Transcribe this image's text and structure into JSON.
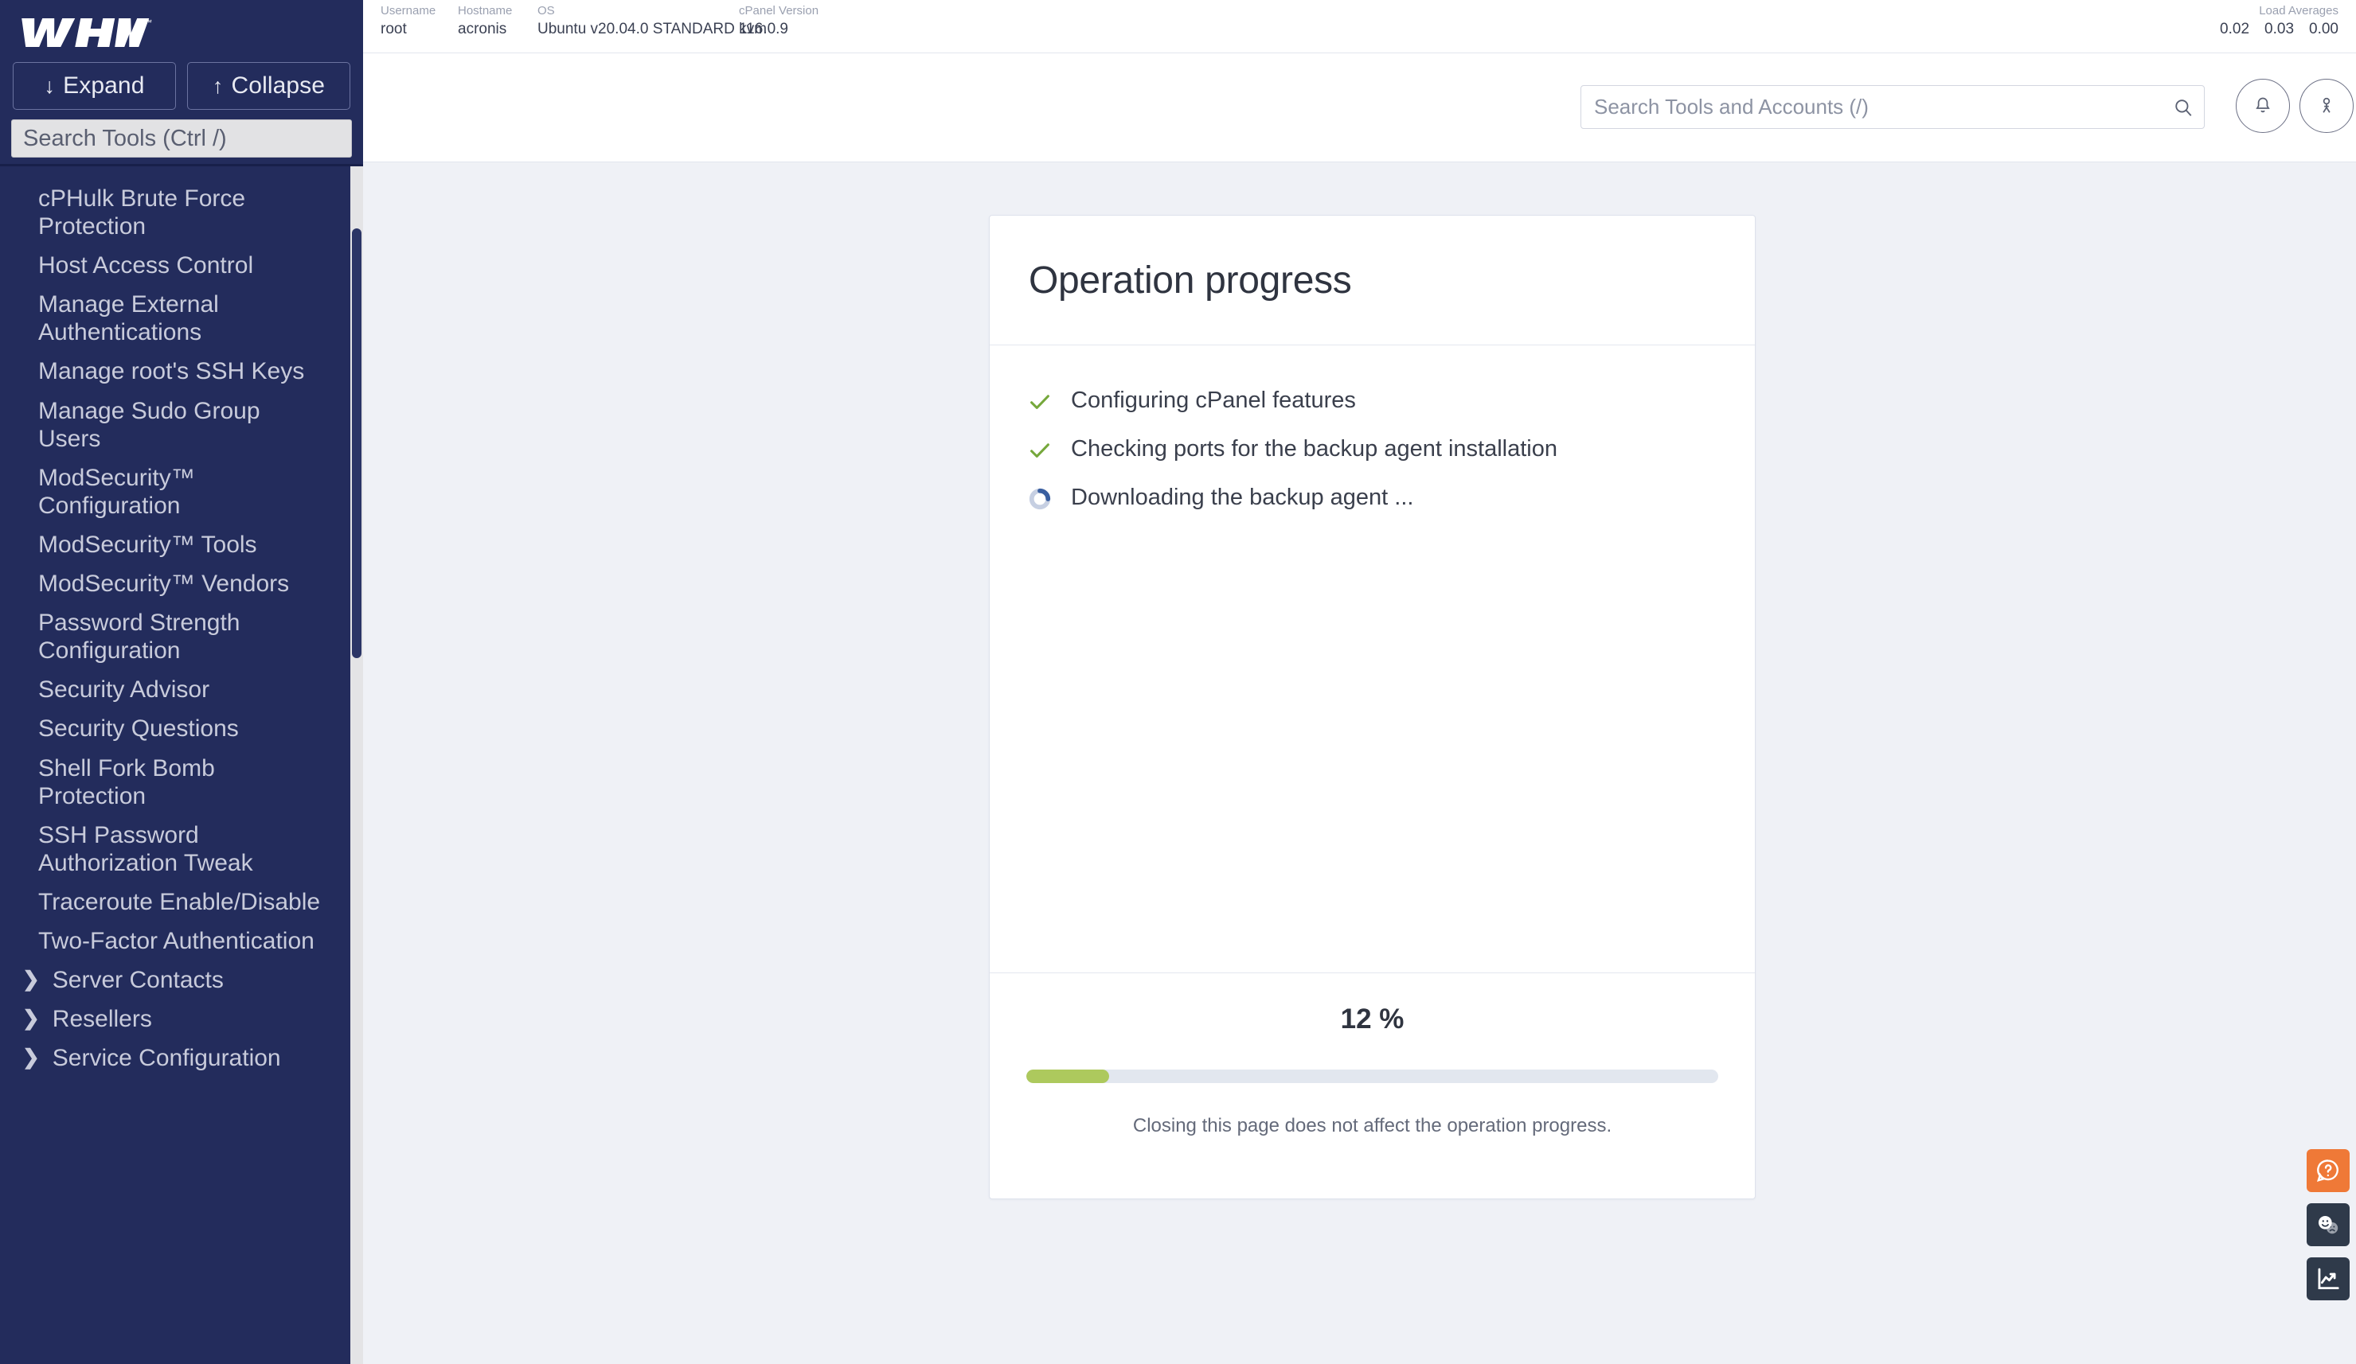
{
  "brand": {
    "logo_text": "WHM"
  },
  "sidebar": {
    "expand_label": "Expand",
    "collapse_label": "Collapse",
    "expand_icon": "arrow-down-icon",
    "collapse_icon": "arrow-up-icon",
    "search_placeholder": "Search Tools (Ctrl /)",
    "search_value": "",
    "items": [
      {
        "label": "cPHulk Brute Force Protection",
        "type": "link"
      },
      {
        "label": "Host Access Control",
        "type": "link"
      },
      {
        "label": "Manage External Authentications",
        "type": "link"
      },
      {
        "label": "Manage root's SSH Keys",
        "type": "link"
      },
      {
        "label": "Manage Sudo Group Users",
        "type": "link"
      },
      {
        "label": "ModSecurity™ Configuration",
        "type": "link"
      },
      {
        "label": "ModSecurity™ Tools",
        "type": "link"
      },
      {
        "label": "ModSecurity™ Vendors",
        "type": "link"
      },
      {
        "label": "Password Strength Configuration",
        "type": "link"
      },
      {
        "label": "Security Advisor",
        "type": "link"
      },
      {
        "label": "Security Questions",
        "type": "link"
      },
      {
        "label": "Shell Fork Bomb Protection",
        "type": "link"
      },
      {
        "label": "SSH Password Authorization Tweak",
        "type": "link"
      },
      {
        "label": "Traceroute Enable/Disable",
        "type": "link"
      },
      {
        "label": "Two-Factor Authentication",
        "type": "link"
      },
      {
        "label": "Server Contacts",
        "type": "group",
        "icon": "chevron-right-icon"
      },
      {
        "label": "Resellers",
        "type": "group",
        "icon": "chevron-right-icon"
      },
      {
        "label": "Service Configuration",
        "type": "group",
        "icon": "chevron-right-icon"
      }
    ]
  },
  "topbar": {
    "username_label": "Username",
    "username_value": "root",
    "hostname_label": "Hostname",
    "hostname_value": "acronis",
    "os_label": "OS",
    "os_value": "Ubuntu v20.04.0 STANDARD kvm",
    "cpanel_version_label": "cPanel Version",
    "cpanel_version_value": "116.0.9",
    "load_averages_label": "Load Averages",
    "load_averages": [
      "0.02",
      "0.03",
      "0.00"
    ]
  },
  "header": {
    "search_placeholder": "Search Tools and Accounts (/)",
    "search_value": "",
    "search_icon": "search-icon",
    "notifications_icon": "bell-icon",
    "account_icon": "user-icon"
  },
  "card": {
    "title": "Operation progress",
    "steps": [
      {
        "label": "Configuring cPanel features",
        "status": "done",
        "icon": "check-icon"
      },
      {
        "label": "Checking ports for the backup agent installation",
        "status": "done",
        "icon": "check-icon"
      },
      {
        "label": "Downloading the backup agent ...",
        "status": "in-progress",
        "icon": "spinner-icon"
      }
    ],
    "percent_text": "12 %",
    "percent_value": 12,
    "footnote": "Closing this page does not affect the operation progress."
  },
  "fabs": [
    {
      "name": "help",
      "icon": "help-chat-icon",
      "color": "#ef7937"
    },
    {
      "name": "feedback",
      "icon": "feedback-faces-icon",
      "color": "#2f3a4a"
    },
    {
      "name": "statistics",
      "icon": "chart-trend-icon",
      "color": "#2f3a4a"
    }
  ],
  "colors": {
    "sidebar_bg": "#232c5c",
    "main_bg": "#eff1f6",
    "progress_fill": "#adc95d",
    "progress_track": "#e2e7ef",
    "check_green": "#76a83c",
    "spinner_blue": "#3a5fa0",
    "accent_orange": "#ef7937"
  }
}
